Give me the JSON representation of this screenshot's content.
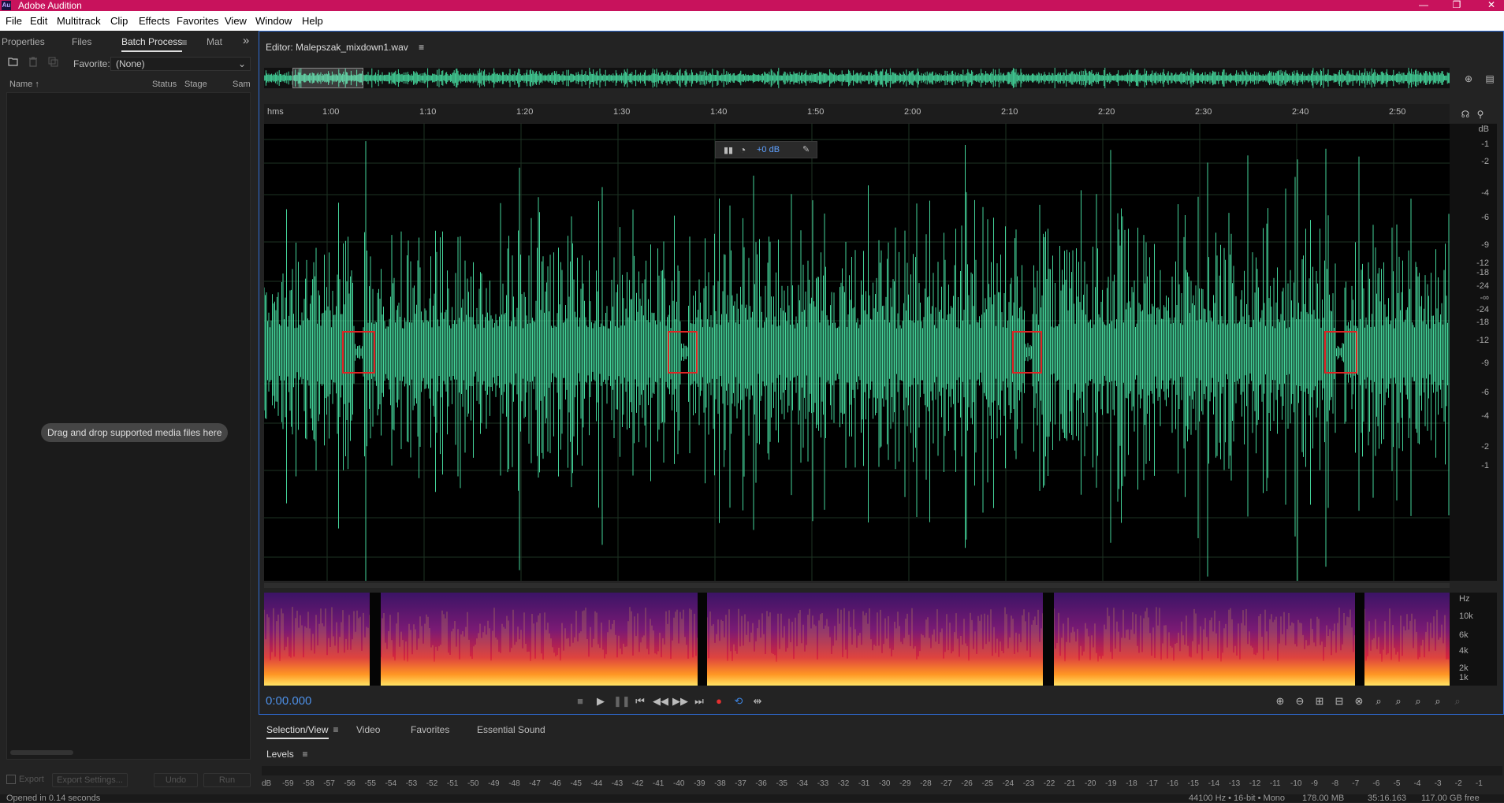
{
  "app": {
    "title": "Adobe Audition",
    "logo": "Au"
  },
  "window_controls": {
    "minimize": "—",
    "restore": "❐",
    "close": "✕"
  },
  "menu": [
    "File",
    "Edit",
    "Multitrack",
    "Clip",
    "Effects",
    "Favorites",
    "View",
    "Window",
    "Help"
  ],
  "left_panel": {
    "tabs": [
      "Properties",
      "Files",
      "Batch Process",
      "Mat"
    ],
    "active_tab": "Batch Process",
    "favorite_label": "Favorite:",
    "favorite_value": "(None)",
    "columns": [
      "Name",
      "Status",
      "Stage",
      "Sam"
    ],
    "drop_message": "Drag and drop supported media files here",
    "export_label": "Export",
    "export_settings": "Export Settings...",
    "undo": "Undo",
    "run": "Run"
  },
  "editor": {
    "title": "Editor: Malepszak_mixdown1.wav",
    "ruler_unit": "hms",
    "ruler_ticks": [
      "1:00",
      "1:10",
      "1:20",
      "1:30",
      "1:40",
      "1:50",
      "2:00",
      "2:10",
      "2:20",
      "2:30",
      "2:40",
      "2:50"
    ],
    "db_label": "dB",
    "db_ticks": [
      "-1",
      "-2",
      "-4",
      "-6",
      "-9",
      "-12",
      "-18",
      "-24",
      "-∞",
      "-24",
      "-18",
      "-12",
      "-9",
      "-6",
      "-4",
      "-2",
      "-1"
    ],
    "volume_hud": "+0 dB",
    "hz_label": "Hz",
    "hz_ticks": [
      "10k",
      "6k",
      "4k",
      "2k",
      "1k"
    ],
    "timecode": "0:00.000",
    "waveform_color": "#44d49a",
    "marker_color": "#e02424"
  },
  "bottom_tabs": [
    "Selection/View",
    "Video",
    "Favorites",
    "Essential Sound"
  ],
  "levels": {
    "title": "Levels",
    "scale": [
      "dB",
      "-59",
      "-58",
      "-57",
      "-56",
      "-55",
      "-54",
      "-53",
      "-52",
      "-51",
      "-50",
      "-49",
      "-48",
      "-47",
      "-46",
      "-45",
      "-44",
      "-43",
      "-42",
      "-41",
      "-40",
      "-39",
      "-38",
      "-37",
      "-36",
      "-35",
      "-34",
      "-33",
      "-32",
      "-31",
      "-30",
      "-29",
      "-28",
      "-27",
      "-26",
      "-25",
      "-24",
      "-23",
      "-22",
      "-21",
      "-20",
      "-19",
      "-18",
      "-17",
      "-16",
      "-15",
      "-14",
      "-13",
      "-12",
      "-11",
      "-10",
      "-9",
      "-8",
      "-7",
      "-6",
      "-5",
      "-4",
      "-3",
      "-2",
      "-1"
    ]
  },
  "status": {
    "left": "Opened in 0.14 seconds",
    "format": "44100 Hz • 16-bit • Mono",
    "size": "178.00 MB",
    "duration": "35:16.163",
    "free": "117.00 GB free"
  }
}
